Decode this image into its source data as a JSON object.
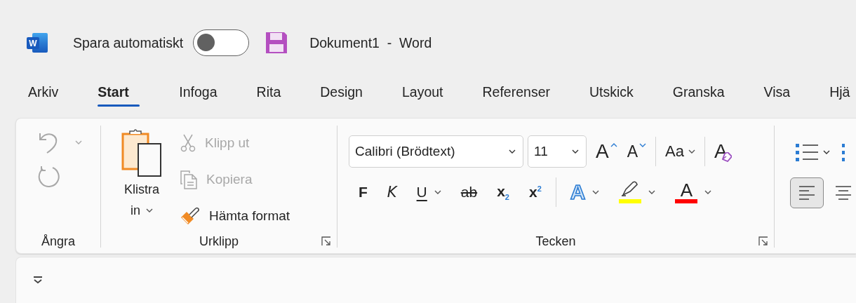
{
  "title_bar": {
    "app_logo": "W",
    "autosave": {
      "label": "Spara automatiskt",
      "on": false
    },
    "document_title": "Dokument1  -  Word"
  },
  "tabs": [
    {
      "label": "Arkiv",
      "selected": false
    },
    {
      "label": "Start",
      "selected": true
    },
    {
      "label": "Infoga",
      "selected": false
    },
    {
      "label": "Rita",
      "selected": false
    },
    {
      "label": "Design",
      "selected": false
    },
    {
      "label": "Layout",
      "selected": false
    },
    {
      "label": "Referenser",
      "selected": false
    },
    {
      "label": "Utskick",
      "selected": false
    },
    {
      "label": "Granska",
      "selected": false
    },
    {
      "label": "Visa",
      "selected": false
    },
    {
      "label": "Hjä",
      "selected": false
    }
  ],
  "ribbon": {
    "undo_group": {
      "label": "Ångra",
      "undo": {
        "disabled": true
      },
      "redo": {
        "disabled": true
      }
    },
    "clipboard_group": {
      "label": "Urklipp",
      "paste_lines": [
        "Klistra",
        "in"
      ],
      "commands": [
        {
          "label": "Klipp ut",
          "kind": "cut",
          "disabled": true
        },
        {
          "label": "Kopiera",
          "kind": "copy",
          "disabled": true
        },
        {
          "label": "Hämta format",
          "kind": "format_painter",
          "disabled": false
        }
      ]
    },
    "font_group": {
      "label": "Tecken",
      "font_name": "Calibri (Brödtext)",
      "font_size": "11",
      "grow_font": "A",
      "shrink_font": "A",
      "change_case": "Aa",
      "clear_format": "A",
      "format_buttons": [
        {
          "label": "F",
          "kind": "bold"
        },
        {
          "label": "K",
          "kind": "italic"
        },
        {
          "label": "U",
          "kind": "underline"
        },
        {
          "label": "ab",
          "kind": "strikethrough"
        },
        {
          "label": "x$_{2}$",
          "kind": "subscript"
        },
        {
          "label": "x$^{2}$",
          "kind": "superscript"
        }
      ],
      "text_effects": "A",
      "highlight": {
        "color": "#ffff00"
      },
      "font_color": {
        "label": "A",
        "color": "#ff0000"
      }
    },
    "paragraph_group": {
      "align_buttons": [
        {
          "kind": "left",
          "selected": true
        },
        {
          "kind": "center",
          "selected": false
        }
      ]
    }
  }
}
